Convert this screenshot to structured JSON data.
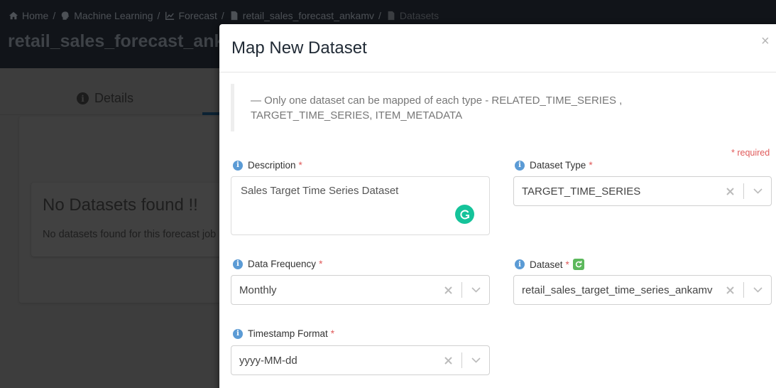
{
  "breadcrumb": [
    {
      "label": "Home",
      "icon": "home-icon"
    },
    {
      "label": "Machine Learning",
      "icon": "brain-icon"
    },
    {
      "label": "Forecast",
      "icon": "chart-line-icon"
    },
    {
      "label": "retail_sales_forecast_ankamv",
      "icon": "file-icon"
    },
    {
      "label": "Datasets",
      "icon": "file-icon"
    }
  ],
  "page": {
    "title": "retail_sales_forecast_ankamv",
    "tabs": [
      {
        "label": "Details",
        "icon": "info-icon"
      }
    ],
    "empty_state": {
      "title": "No Datasets found !!",
      "text": "No datasets found for this forecast job"
    }
  },
  "modal": {
    "title": "Map New Dataset",
    "close_label": "×",
    "note_line1": "— Only one dataset can be mapped of each type - RELATED_TIME_SERIES ,",
    "note_line2": "TARGET_TIME_SERIES, ITEM_METADATA",
    "required_note": "* required",
    "fields": {
      "description": {
        "label": "Description",
        "required_mark": "*",
        "value": "Sales Target Time Series Dataset"
      },
      "dataset_type": {
        "label": "Dataset Type",
        "required_mark": "*",
        "value": "TARGET_TIME_SERIES"
      },
      "data_frequency": {
        "label": "Data Frequency",
        "required_mark": "*",
        "value": "Monthly"
      },
      "dataset": {
        "label": "Dataset",
        "required_mark": "*",
        "value": "retail_sales_target_time_series_ankamv"
      },
      "timestamp_format": {
        "label": "Timestamp Format",
        "required_mark": "*",
        "value": "yyyy-MM-dd"
      }
    }
  }
}
